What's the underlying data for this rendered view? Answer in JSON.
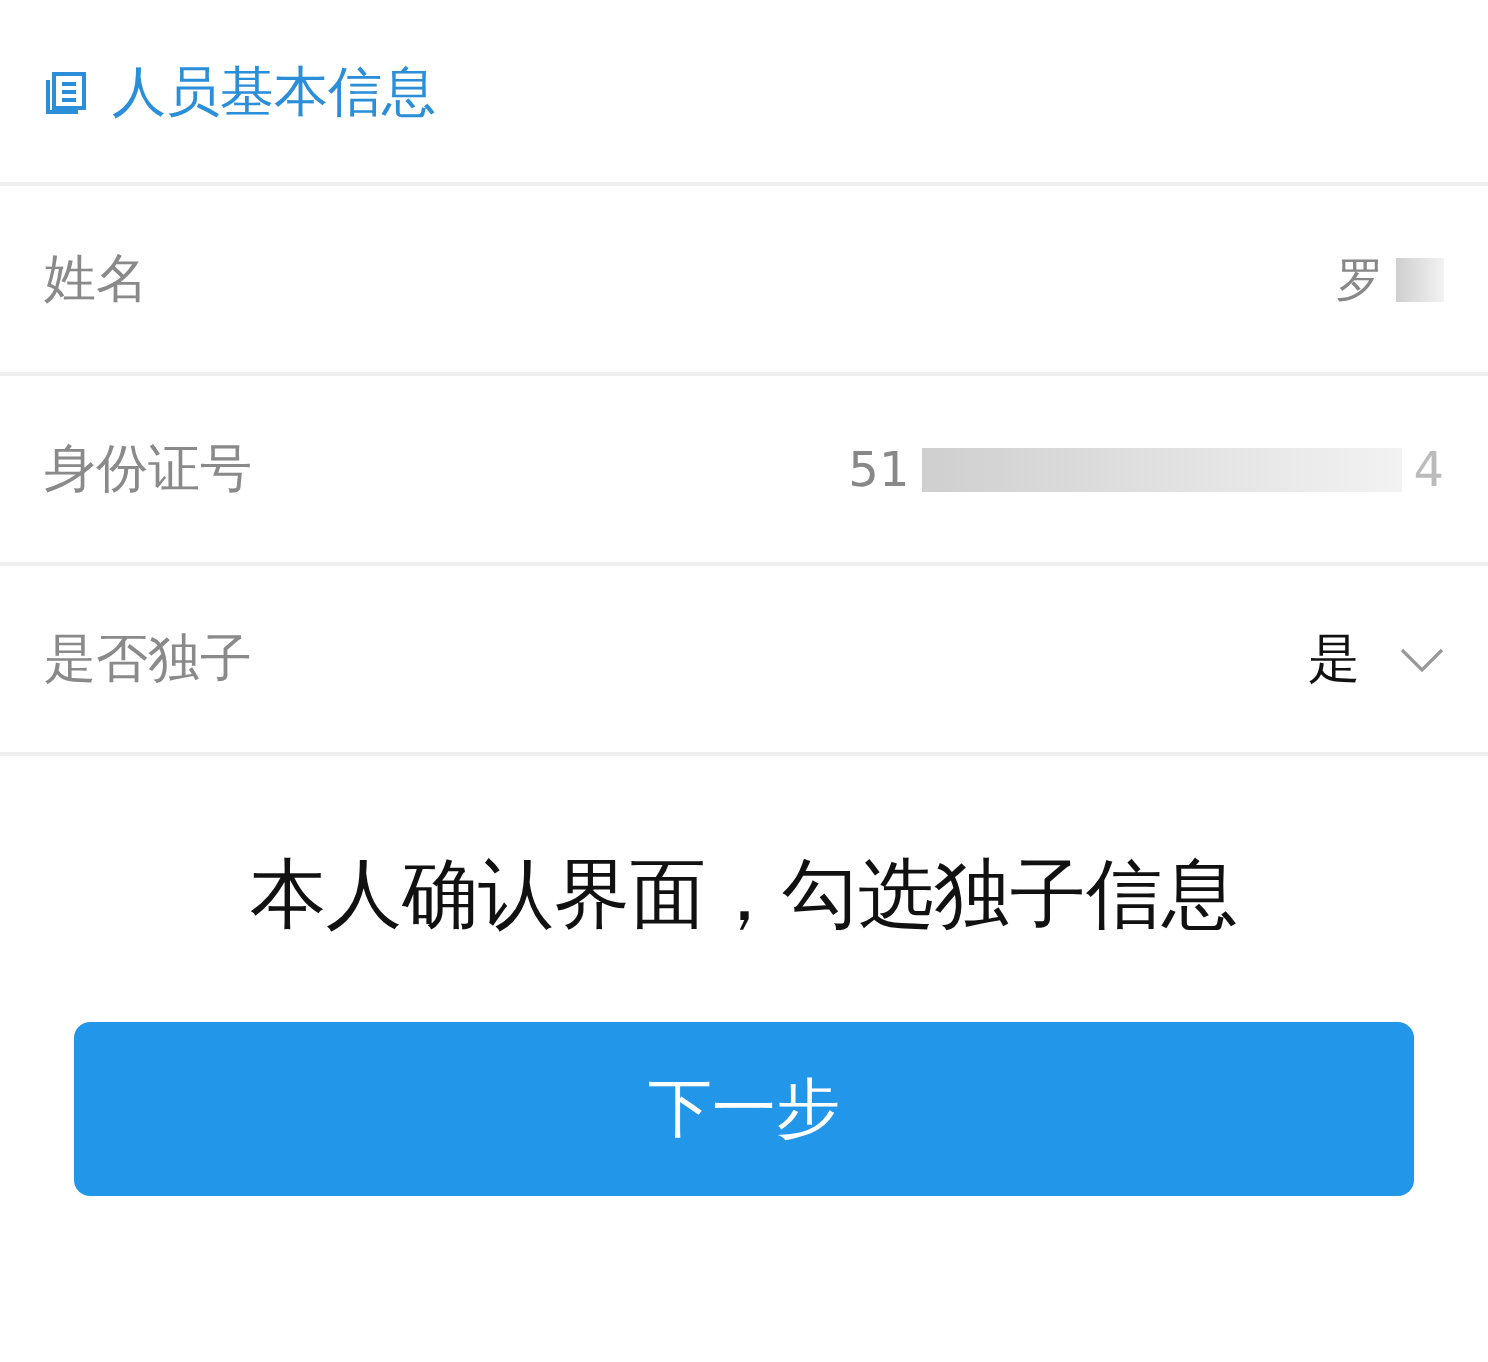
{
  "section": {
    "title": "人员基本信息"
  },
  "fields": [
    {
      "kind": "text",
      "label": "姓名",
      "value": "罗",
      "redacted": true
    },
    {
      "kind": "id",
      "label": "身份证号",
      "value": "51",
      "value_end": "4",
      "redacted": true
    },
    {
      "kind": "select",
      "label": "是否独子",
      "value": "是"
    }
  ],
  "caption": "本人确认界面，勾选独子信息",
  "button": "下一步"
}
